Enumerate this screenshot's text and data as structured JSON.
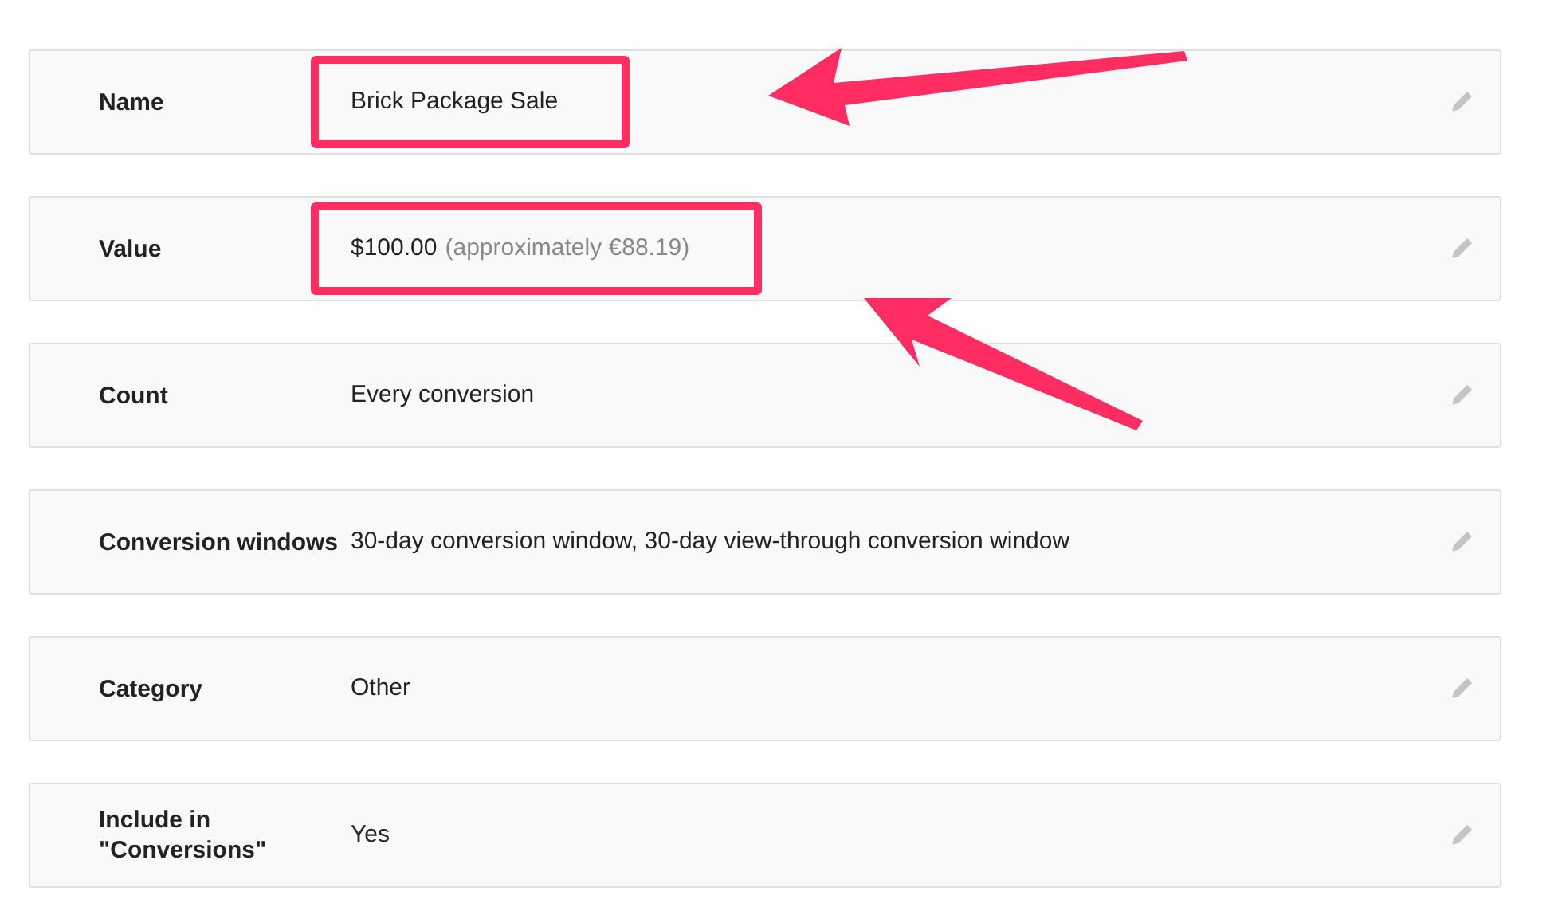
{
  "rows": [
    {
      "label": "Name",
      "value": "Brick Package Sale",
      "highlighted": true
    },
    {
      "label": "Value",
      "value": "$100.00",
      "note": "(approximately €88.19)",
      "highlighted": true
    },
    {
      "label": "Count",
      "value": "Every conversion",
      "highlighted": false
    },
    {
      "label": "Conversion windows",
      "value": "30-day conversion window, 30-day view-through conversion window",
      "highlighted": false
    },
    {
      "label": "Category",
      "value": "Other",
      "highlighted": false
    },
    {
      "label": "Include in \"Conversions\"",
      "value": "Yes",
      "highlighted": false
    }
  ]
}
